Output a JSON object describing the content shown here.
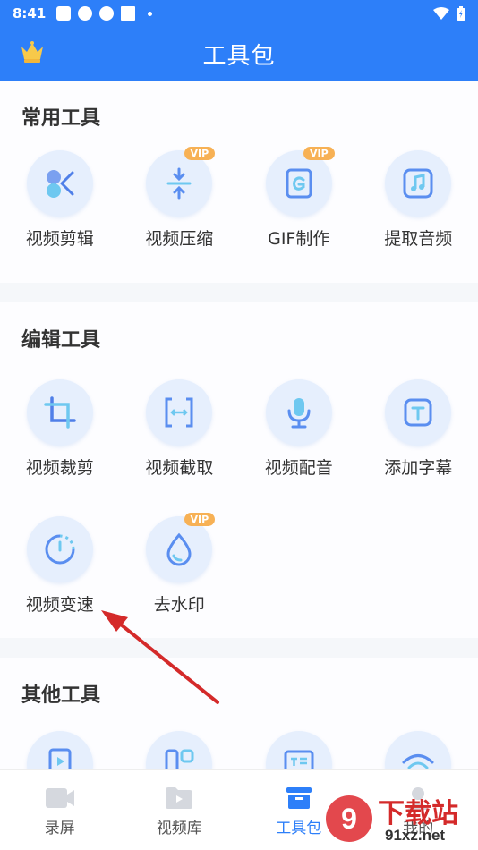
{
  "status": {
    "time": "8:41"
  },
  "header": {
    "title": "工具包"
  },
  "sections": [
    {
      "title": "常用工具",
      "items": [
        {
          "label": "视频剪辑",
          "icon": "scissors-icon",
          "vip": ""
        },
        {
          "label": "视频压缩",
          "icon": "compress-icon",
          "vip": "VIP"
        },
        {
          "label": "GIF制作",
          "icon": "gif-icon",
          "vip": "VIP"
        },
        {
          "label": "提取音频",
          "icon": "music-icon",
          "vip": ""
        }
      ]
    },
    {
      "title": "编辑工具",
      "items": [
        {
          "label": "视频裁剪",
          "icon": "crop-icon",
          "vip": ""
        },
        {
          "label": "视频截取",
          "icon": "trim-icon",
          "vip": ""
        },
        {
          "label": "视频配音",
          "icon": "microphone-icon",
          "vip": ""
        },
        {
          "label": "添加字幕",
          "icon": "subtitle-icon",
          "vip": ""
        },
        {
          "label": "视频变速",
          "icon": "speed-icon",
          "vip": ""
        },
        {
          "label": "去水印",
          "icon": "water-drop-icon",
          "vip": "VIP"
        }
      ]
    },
    {
      "title": "其他工具"
    }
  ],
  "tabbar": {
    "tabs": [
      {
        "label": "录屏"
      },
      {
        "label": "视频库"
      },
      {
        "label": "工具包"
      },
      {
        "label": "我的"
      }
    ]
  },
  "watermark": {
    "brand": "下载站",
    "domain": "91xz.net"
  },
  "colors": {
    "primary": "#2d7ff9",
    "vip": "#f7b155",
    "arrow": "#d42a2a"
  }
}
